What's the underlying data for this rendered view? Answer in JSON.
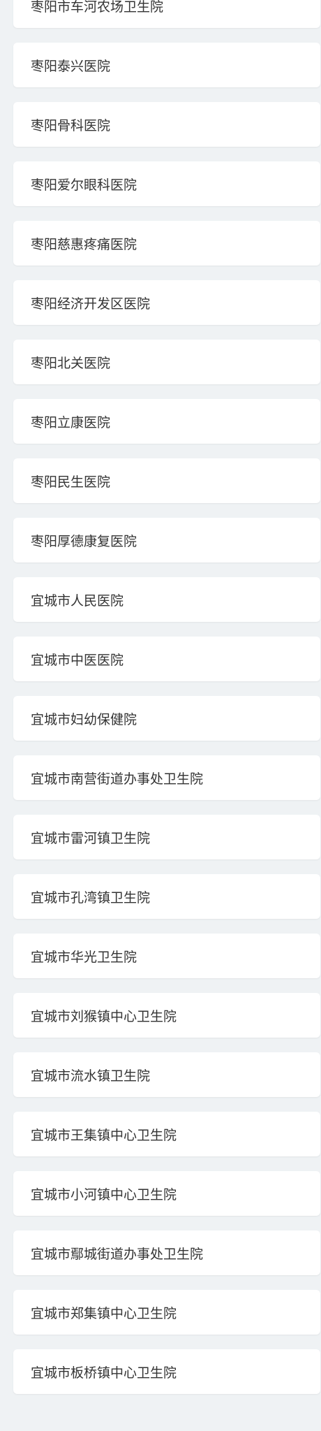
{
  "hospital_list": {
    "items": [
      {
        "name": "枣阳市车河农场卫生院"
      },
      {
        "name": "枣阳泰兴医院"
      },
      {
        "name": "枣阳骨科医院"
      },
      {
        "name": "枣阳爱尔眼科医院"
      },
      {
        "name": "枣阳慈惠疼痛医院"
      },
      {
        "name": "枣阳经济开发区医院"
      },
      {
        "name": "枣阳北关医院"
      },
      {
        "name": "枣阳立康医院"
      },
      {
        "name": "枣阳民生医院"
      },
      {
        "name": "枣阳厚德康复医院"
      },
      {
        "name": "宜城市人民医院"
      },
      {
        "name": "宜城市中医医院"
      },
      {
        "name": "宜城市妇幼保健院"
      },
      {
        "name": "宜城市南营街道办事处卫生院"
      },
      {
        "name": "宜城市雷河镇卫生院"
      },
      {
        "name": "宜城市孔湾镇卫生院"
      },
      {
        "name": "宜城市华光卫生院"
      },
      {
        "name": "宜城市刘猴镇中心卫生院"
      },
      {
        "name": "宜城市流水镇卫生院"
      },
      {
        "name": "宜城市王集镇中心卫生院"
      },
      {
        "name": "宜城市小河镇中心卫生院"
      },
      {
        "name": "宜城市鄢城街道办事处卫生院"
      },
      {
        "name": "宜城市郑集镇中心卫生院"
      },
      {
        "name": "宜城市板桥镇中心卫生院"
      }
    ]
  }
}
